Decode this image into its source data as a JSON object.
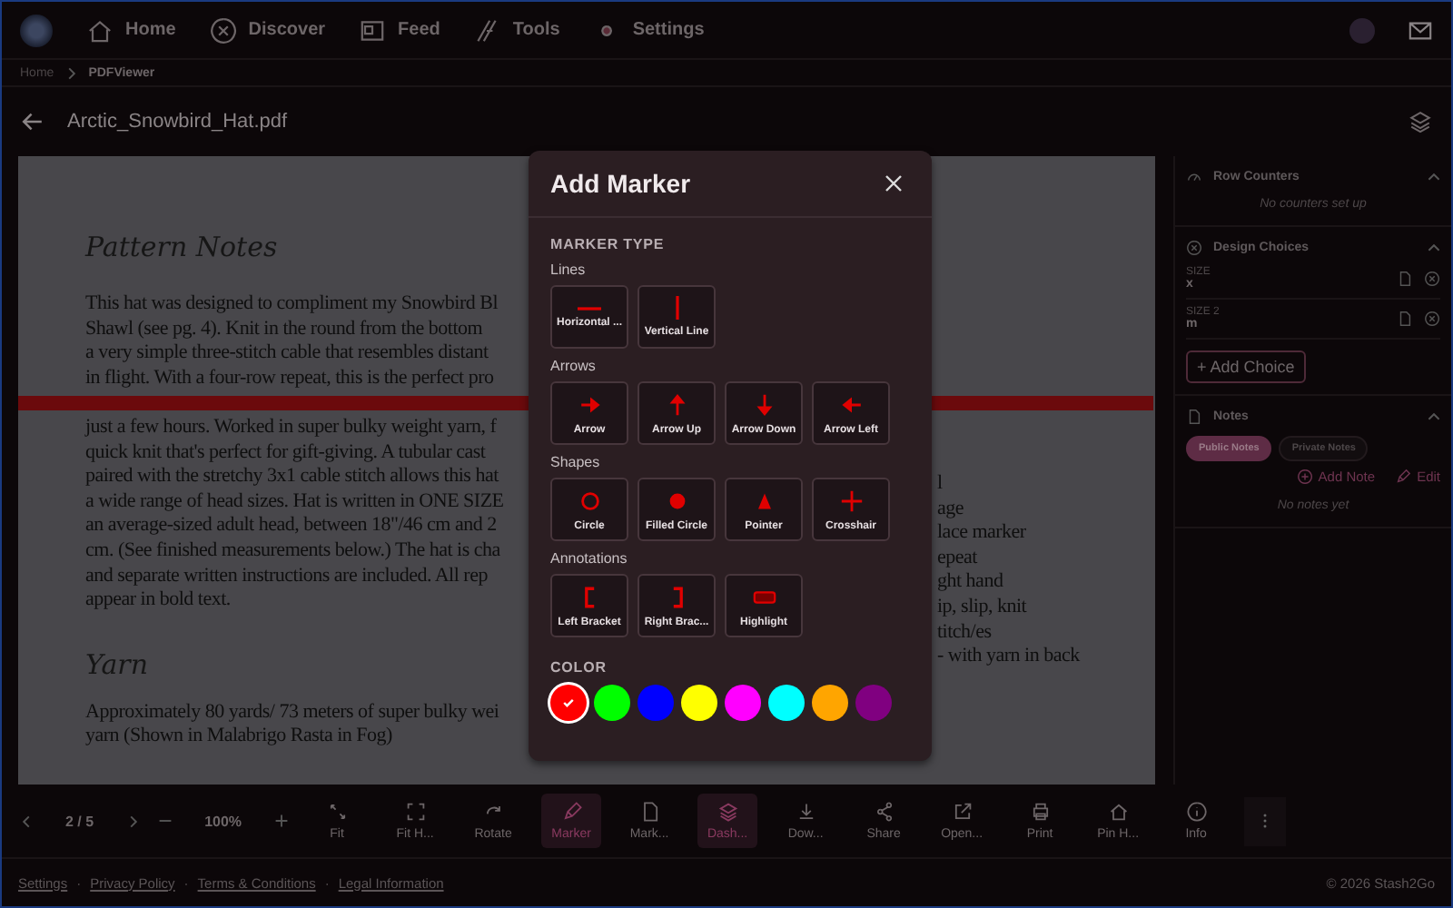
{
  "nav": {
    "items": [
      {
        "label": "Home"
      },
      {
        "label": "Discover"
      },
      {
        "label": "Feed"
      },
      {
        "label": "Tools"
      },
      {
        "label": "Settings"
      }
    ]
  },
  "breadcrumb": [
    "Home",
    "PDFViewer"
  ],
  "file_title": "Arctic_Snowbird_Hat.pdf",
  "document": {
    "heading": "Pattern Notes",
    "lines": [
      "This hat was designed to compliment my Snowbird Bl",
      "Shawl (see pg. 4). Knit in the round from the bottom",
      "a very simple three-stitch cable that resembles distant",
      "in flight. With a four-row repeat, this is the perfect pro"
    ],
    "lines_after_marker": [
      "just a few hours. Worked in super bulky weight yarn, f",
      "quick knit that's perfect for gift-giving. A tubular cast",
      "paired with the stretchy 3x1 cable stitch allows this hat",
      "a wide range of head sizes. Hat is written in ONE SIZE",
      "an average-sized adult head, between 18\"/46 cm and 2",
      "cm. (See finished measurements below.) The hat is cha",
      "and separate written instructions are included. All rep",
      "appear in bold text."
    ],
    "heading_2": "Yarn",
    "lines_2": [
      "Approximately 80 yards/ 73 meters of super bulky wei",
      "yarn (Shown in Malabrigo Rasta in Fog)"
    ],
    "right_fragments": [
      "l",
      "age",
      "lace marker",
      "epeat",
      "ght hand",
      "ip, slip, knit",
      "titch/es",
      "- with yarn in back"
    ]
  },
  "sidebar": {
    "row_counters": {
      "title": "Row Counters",
      "empty": "No counters set up"
    },
    "design_choices": {
      "title": "Design Choices",
      "items": [
        {
          "label": "SIZE",
          "value": "x"
        },
        {
          "label": "SIZE 2",
          "value": "m"
        }
      ],
      "add": "+ Add Choice"
    },
    "notes": {
      "title": "Notes",
      "tabs": [
        {
          "label": "Public Notes",
          "selected": true
        },
        {
          "label": "Private Notes",
          "selected": false
        }
      ],
      "add": "Add Note",
      "edit": "Edit",
      "empty": "No notes yet"
    }
  },
  "toolbar": {
    "page": "2 / 5",
    "zoom": "100%",
    "items": [
      {
        "label": "Fit",
        "active": false
      },
      {
        "label": "Fit H...",
        "active": false
      },
      {
        "label": "Rotate",
        "active": false
      },
      {
        "label": "Marker",
        "active": true
      },
      {
        "label": "Mark...",
        "active": false
      },
      {
        "label": "Dash...",
        "active": true
      },
      {
        "label": "Dow...",
        "active": false
      },
      {
        "label": "Share",
        "active": false
      },
      {
        "label": "Open...",
        "active": false
      },
      {
        "label": "Print",
        "active": false
      },
      {
        "label": "Pin H...",
        "active": false
      },
      {
        "label": "Info",
        "active": false
      }
    ]
  },
  "footer": {
    "links": [
      "Settings",
      "Privacy Policy",
      "Terms & Conditions",
      "Legal Information"
    ],
    "separator": "·",
    "copyright": "© 2026 Stash2Go"
  },
  "modal": {
    "title": "Add Marker",
    "section": "MARKER TYPE",
    "groups": [
      {
        "title": "Lines",
        "items": [
          {
            "label": "Horizontal ...",
            "kind": "hline"
          },
          {
            "label": "Vertical Line",
            "kind": "vline"
          }
        ]
      },
      {
        "title": "Arrows",
        "items": [
          {
            "label": "Arrow",
            "kind": "arrow-right"
          },
          {
            "label": "Arrow Up",
            "kind": "arrow-up"
          },
          {
            "label": "Arrow Down",
            "kind": "arrow-down"
          },
          {
            "label": "Arrow Left",
            "kind": "arrow-left"
          }
        ]
      },
      {
        "title": "Shapes",
        "items": [
          {
            "label": "Circle",
            "kind": "circle"
          },
          {
            "label": "Filled Circle",
            "kind": "filled-circle"
          },
          {
            "label": "Pointer",
            "kind": "pointer"
          },
          {
            "label": "Crosshair",
            "kind": "crosshair"
          }
        ]
      },
      {
        "title": "Annotations",
        "items": [
          {
            "label": "Left Bracket",
            "kind": "left-bracket"
          },
          {
            "label": "Right Brac...",
            "kind": "right-bracket"
          },
          {
            "label": "Highlight",
            "kind": "highlight"
          }
        ]
      }
    ],
    "color_title": "COLOR",
    "colors": [
      {
        "color": "#ff0000",
        "selected": true
      },
      {
        "color": "#00ff00",
        "selected": false
      },
      {
        "color": "#0000ff",
        "selected": false
      },
      {
        "color": "#ffff00",
        "selected": false
      },
      {
        "color": "#ff00ff",
        "selected": false
      },
      {
        "color": "#00ffff",
        "selected": false
      },
      {
        "color": "#ffa500",
        "selected": false
      },
      {
        "color": "#800080",
        "selected": false
      }
    ]
  }
}
